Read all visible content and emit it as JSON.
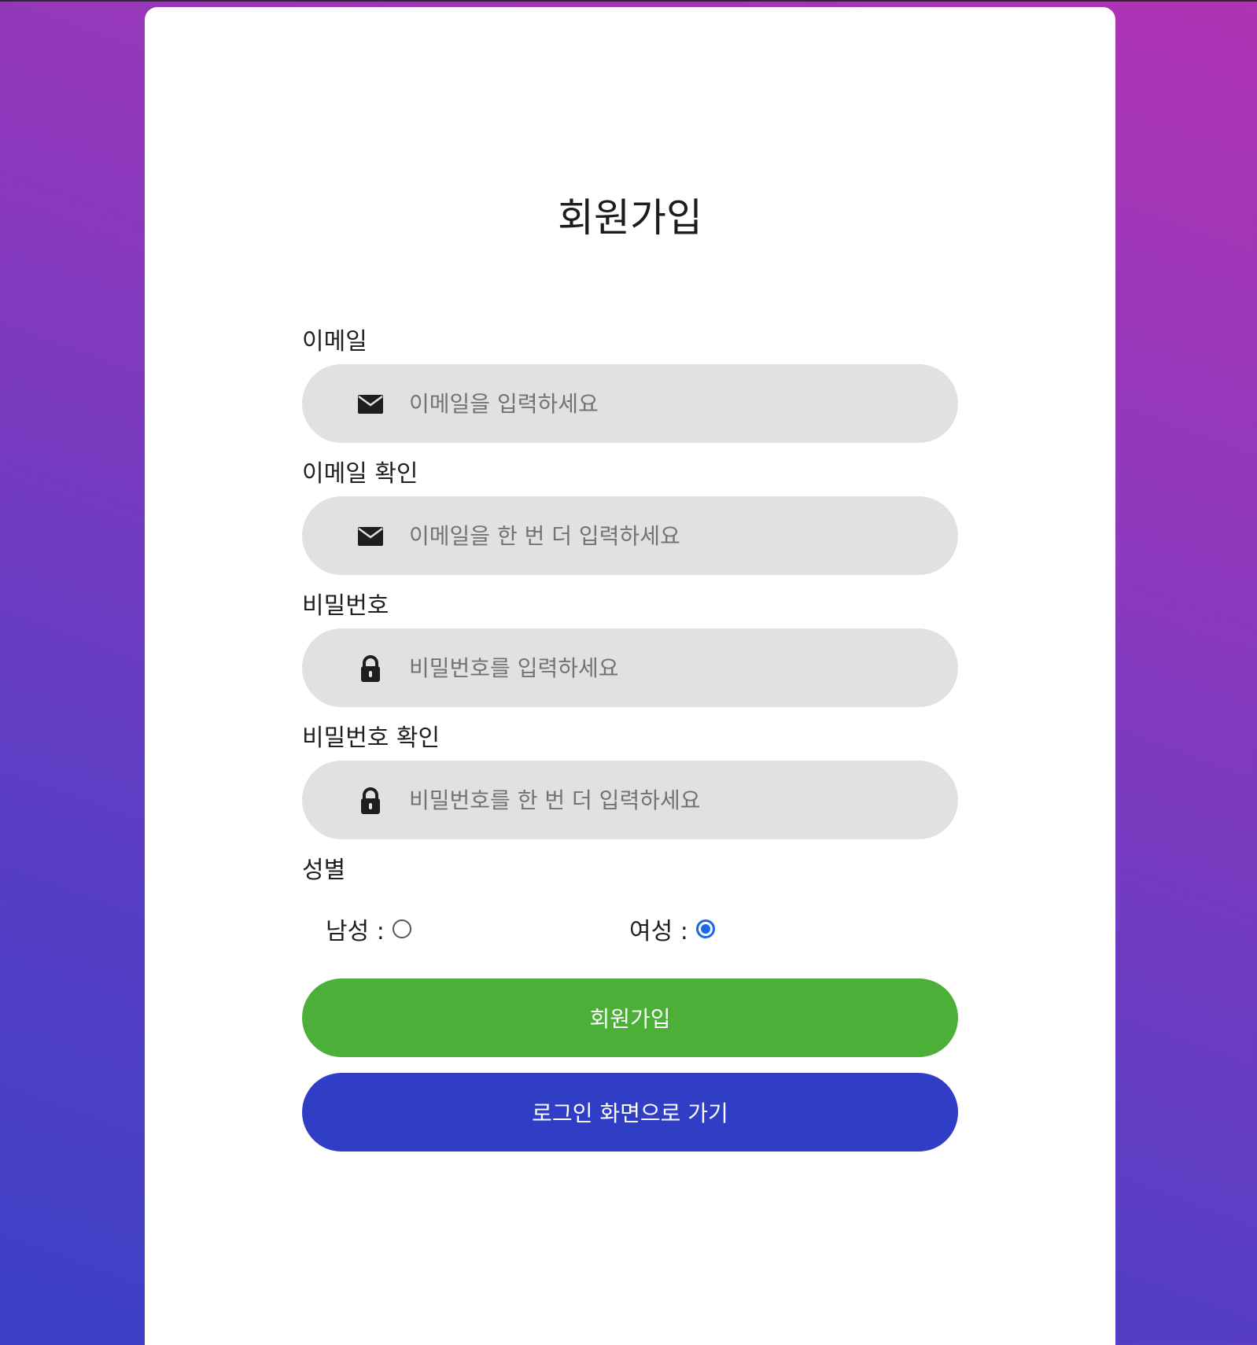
{
  "page": {
    "title": "회원가입"
  },
  "fields": [
    {
      "label": "이메일",
      "placeholder": "이메일을 입력하세요",
      "icon": "envelope-icon"
    },
    {
      "label": "이메일 확인",
      "placeholder": "이메일을 한 번 더 입력하세요",
      "icon": "envelope-icon"
    },
    {
      "label": "비밀번호",
      "placeholder": "비밀번호를 입력하세요",
      "icon": "lock-icon"
    },
    {
      "label": "비밀번호 확인",
      "placeholder": "비밀번호를 한 번 더 입력하세요",
      "icon": "lock-icon"
    }
  ],
  "gender": {
    "label": "성별",
    "options": [
      {
        "label": "남성 :",
        "checked": false
      },
      {
        "label": "여성 :",
        "checked": true
      }
    ]
  },
  "buttons": {
    "signup": "회원가입",
    "login": "로그인 화면으로 가기"
  },
  "colors": {
    "signup_button": "#4caf37",
    "login_button": "#303ec6",
    "radio_selected": "#1769e8",
    "input_background": "#e1e1e1"
  }
}
